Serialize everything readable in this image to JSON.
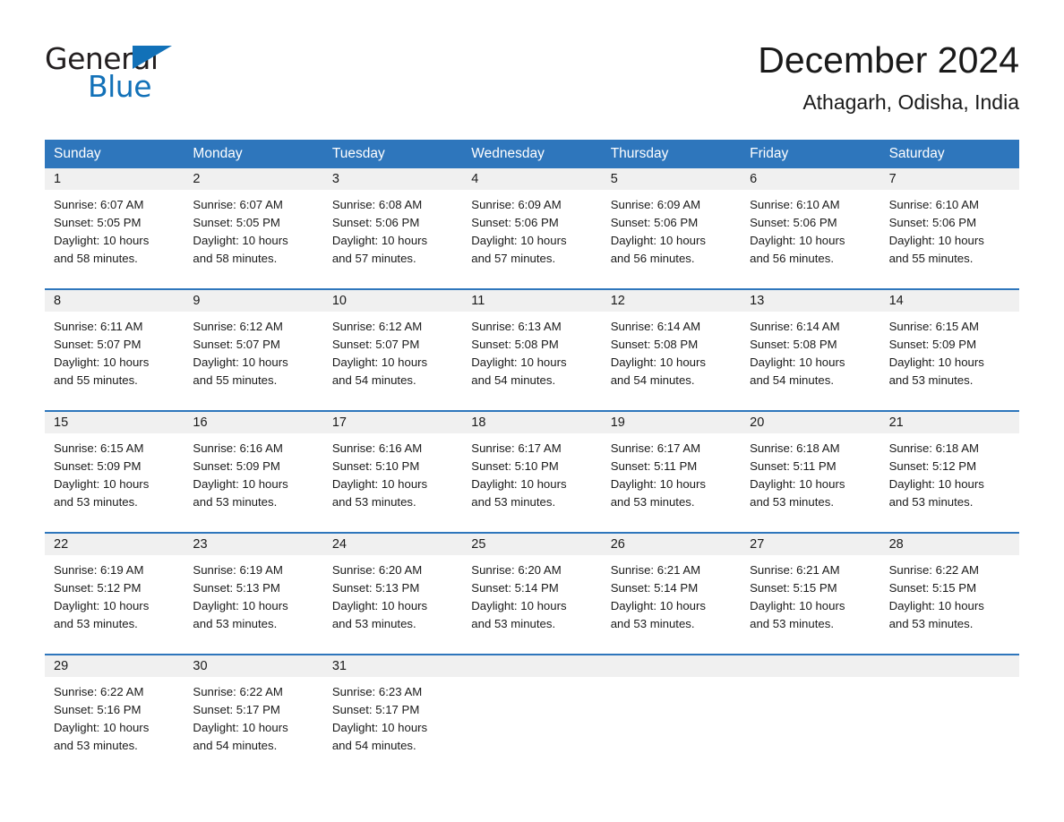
{
  "brand": {
    "name_part1": "General",
    "name_part2": "Blue",
    "triangle_icon": "blue-triangle-icon",
    "accent_color": "#1271b8"
  },
  "header": {
    "title": "December 2024",
    "subtitle": "Athagarh, Odisha, India"
  },
  "colors": {
    "header_blue": "#2e76bc",
    "daynum_band": "#f0f0f0",
    "text": "#1a1a1a"
  },
  "calendar": {
    "weekday_headers": [
      "Sunday",
      "Monday",
      "Tuesday",
      "Wednesday",
      "Thursday",
      "Friday",
      "Saturday"
    ],
    "weeks": [
      [
        {
          "day": "1",
          "sunrise": "Sunrise: 6:07 AM",
          "sunset": "Sunset: 5:05 PM",
          "daylight_line1": "Daylight: 10 hours",
          "daylight_line2": "and 58 minutes."
        },
        {
          "day": "2",
          "sunrise": "Sunrise: 6:07 AM",
          "sunset": "Sunset: 5:05 PM",
          "daylight_line1": "Daylight: 10 hours",
          "daylight_line2": "and 58 minutes."
        },
        {
          "day": "3",
          "sunrise": "Sunrise: 6:08 AM",
          "sunset": "Sunset: 5:06 PM",
          "daylight_line1": "Daylight: 10 hours",
          "daylight_line2": "and 57 minutes."
        },
        {
          "day": "4",
          "sunrise": "Sunrise: 6:09 AM",
          "sunset": "Sunset: 5:06 PM",
          "daylight_line1": "Daylight: 10 hours",
          "daylight_line2": "and 57 minutes."
        },
        {
          "day": "5",
          "sunrise": "Sunrise: 6:09 AM",
          "sunset": "Sunset: 5:06 PM",
          "daylight_line1": "Daylight: 10 hours",
          "daylight_line2": "and 56 minutes."
        },
        {
          "day": "6",
          "sunrise": "Sunrise: 6:10 AM",
          "sunset": "Sunset: 5:06 PM",
          "daylight_line1": "Daylight: 10 hours",
          "daylight_line2": "and 56 minutes."
        },
        {
          "day": "7",
          "sunrise": "Sunrise: 6:10 AM",
          "sunset": "Sunset: 5:06 PM",
          "daylight_line1": "Daylight: 10 hours",
          "daylight_line2": "and 55 minutes."
        }
      ],
      [
        {
          "day": "8",
          "sunrise": "Sunrise: 6:11 AM",
          "sunset": "Sunset: 5:07 PM",
          "daylight_line1": "Daylight: 10 hours",
          "daylight_line2": "and 55 minutes."
        },
        {
          "day": "9",
          "sunrise": "Sunrise: 6:12 AM",
          "sunset": "Sunset: 5:07 PM",
          "daylight_line1": "Daylight: 10 hours",
          "daylight_line2": "and 55 minutes."
        },
        {
          "day": "10",
          "sunrise": "Sunrise: 6:12 AM",
          "sunset": "Sunset: 5:07 PM",
          "daylight_line1": "Daylight: 10 hours",
          "daylight_line2": "and 54 minutes."
        },
        {
          "day": "11",
          "sunrise": "Sunrise: 6:13 AM",
          "sunset": "Sunset: 5:08 PM",
          "daylight_line1": "Daylight: 10 hours",
          "daylight_line2": "and 54 minutes."
        },
        {
          "day": "12",
          "sunrise": "Sunrise: 6:14 AM",
          "sunset": "Sunset: 5:08 PM",
          "daylight_line1": "Daylight: 10 hours",
          "daylight_line2": "and 54 minutes."
        },
        {
          "day": "13",
          "sunrise": "Sunrise: 6:14 AM",
          "sunset": "Sunset: 5:08 PM",
          "daylight_line1": "Daylight: 10 hours",
          "daylight_line2": "and 54 minutes."
        },
        {
          "day": "14",
          "sunrise": "Sunrise: 6:15 AM",
          "sunset": "Sunset: 5:09 PM",
          "daylight_line1": "Daylight: 10 hours",
          "daylight_line2": "and 53 minutes."
        }
      ],
      [
        {
          "day": "15",
          "sunrise": "Sunrise: 6:15 AM",
          "sunset": "Sunset: 5:09 PM",
          "daylight_line1": "Daylight: 10 hours",
          "daylight_line2": "and 53 minutes."
        },
        {
          "day": "16",
          "sunrise": "Sunrise: 6:16 AM",
          "sunset": "Sunset: 5:09 PM",
          "daylight_line1": "Daylight: 10 hours",
          "daylight_line2": "and 53 minutes."
        },
        {
          "day": "17",
          "sunrise": "Sunrise: 6:16 AM",
          "sunset": "Sunset: 5:10 PM",
          "daylight_line1": "Daylight: 10 hours",
          "daylight_line2": "and 53 minutes."
        },
        {
          "day": "18",
          "sunrise": "Sunrise: 6:17 AM",
          "sunset": "Sunset: 5:10 PM",
          "daylight_line1": "Daylight: 10 hours",
          "daylight_line2": "and 53 minutes."
        },
        {
          "day": "19",
          "sunrise": "Sunrise: 6:17 AM",
          "sunset": "Sunset: 5:11 PM",
          "daylight_line1": "Daylight: 10 hours",
          "daylight_line2": "and 53 minutes."
        },
        {
          "day": "20",
          "sunrise": "Sunrise: 6:18 AM",
          "sunset": "Sunset: 5:11 PM",
          "daylight_line1": "Daylight: 10 hours",
          "daylight_line2": "and 53 minutes."
        },
        {
          "day": "21",
          "sunrise": "Sunrise: 6:18 AM",
          "sunset": "Sunset: 5:12 PM",
          "daylight_line1": "Daylight: 10 hours",
          "daylight_line2": "and 53 minutes."
        }
      ],
      [
        {
          "day": "22",
          "sunrise": "Sunrise: 6:19 AM",
          "sunset": "Sunset: 5:12 PM",
          "daylight_line1": "Daylight: 10 hours",
          "daylight_line2": "and 53 minutes."
        },
        {
          "day": "23",
          "sunrise": "Sunrise: 6:19 AM",
          "sunset": "Sunset: 5:13 PM",
          "daylight_line1": "Daylight: 10 hours",
          "daylight_line2": "and 53 minutes."
        },
        {
          "day": "24",
          "sunrise": "Sunrise: 6:20 AM",
          "sunset": "Sunset: 5:13 PM",
          "daylight_line1": "Daylight: 10 hours",
          "daylight_line2": "and 53 minutes."
        },
        {
          "day": "25",
          "sunrise": "Sunrise: 6:20 AM",
          "sunset": "Sunset: 5:14 PM",
          "daylight_line1": "Daylight: 10 hours",
          "daylight_line2": "and 53 minutes."
        },
        {
          "day": "26",
          "sunrise": "Sunrise: 6:21 AM",
          "sunset": "Sunset: 5:14 PM",
          "daylight_line1": "Daylight: 10 hours",
          "daylight_line2": "and 53 minutes."
        },
        {
          "day": "27",
          "sunrise": "Sunrise: 6:21 AM",
          "sunset": "Sunset: 5:15 PM",
          "daylight_line1": "Daylight: 10 hours",
          "daylight_line2": "and 53 minutes."
        },
        {
          "day": "28",
          "sunrise": "Sunrise: 6:22 AM",
          "sunset": "Sunset: 5:15 PM",
          "daylight_line1": "Daylight: 10 hours",
          "daylight_line2": "and 53 minutes."
        }
      ],
      [
        {
          "day": "29",
          "sunrise": "Sunrise: 6:22 AM",
          "sunset": "Sunset: 5:16 PM",
          "daylight_line1": "Daylight: 10 hours",
          "daylight_line2": "and 53 minutes."
        },
        {
          "day": "30",
          "sunrise": "Sunrise: 6:22 AM",
          "sunset": "Sunset: 5:17 PM",
          "daylight_line1": "Daylight: 10 hours",
          "daylight_line2": "and 54 minutes."
        },
        {
          "day": "31",
          "sunrise": "Sunrise: 6:23 AM",
          "sunset": "Sunset: 5:17 PM",
          "daylight_line1": "Daylight: 10 hours",
          "daylight_line2": "and 54 minutes."
        },
        {
          "day": "",
          "sunrise": "",
          "sunset": "",
          "daylight_line1": "",
          "daylight_line2": ""
        },
        {
          "day": "",
          "sunrise": "",
          "sunset": "",
          "daylight_line1": "",
          "daylight_line2": ""
        },
        {
          "day": "",
          "sunrise": "",
          "sunset": "",
          "daylight_line1": "",
          "daylight_line2": ""
        },
        {
          "day": "",
          "sunrise": "",
          "sunset": "",
          "daylight_line1": "",
          "daylight_line2": ""
        }
      ]
    ]
  }
}
